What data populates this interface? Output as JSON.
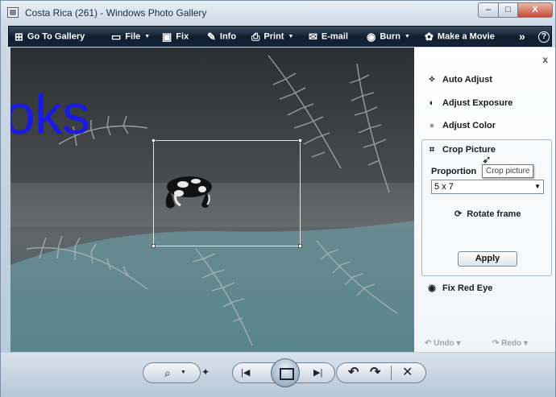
{
  "window": {
    "title": "Costa Rica (261) - Windows Photo Gallery",
    "min": "–",
    "max": "□",
    "close": "X"
  },
  "toolbar": {
    "go_to_gallery": "Go To Gallery",
    "file": "File",
    "fix": "Fix",
    "info": "Info",
    "print": "Print",
    "email": "E-mail",
    "burn": "Burn",
    "make_movie": "Make a Movie",
    "more": "»",
    "help": "?"
  },
  "image": {
    "overlay_text": "oks"
  },
  "panel": {
    "close": "x",
    "auto_adjust": "Auto Adjust",
    "adjust_exposure": "Adjust Exposure",
    "adjust_color": "Adjust Color",
    "crop_picture": "Crop Picture",
    "proportion_label": "Proportion",
    "proportion_value": "5 x 7",
    "tooltip": "Crop picture",
    "rotate_frame": "Rotate frame",
    "apply": "Apply",
    "fix_red_eye": "Fix Red Eye",
    "undo": "Undo",
    "redo": "Redo"
  },
  "icons": {
    "zoom": "⌕",
    "fit": "✦",
    "prev": "|◀",
    "next": "▶|",
    "rotate_left": "↶",
    "rotate_right": "↷",
    "delete": "✕"
  }
}
